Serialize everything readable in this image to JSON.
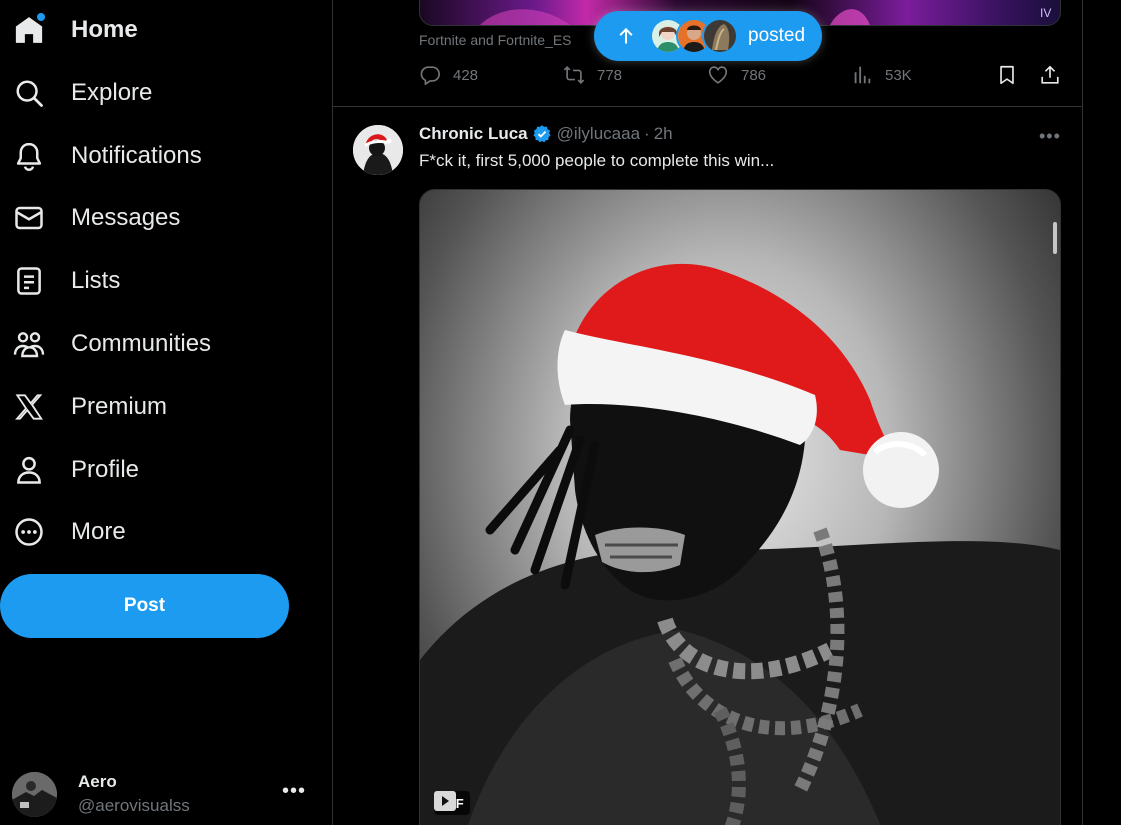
{
  "colors": {
    "accent": "#1d9bf0",
    "background": "#000000",
    "text": "#e7e9ea",
    "muted": "#71767b",
    "border": "#2f3336"
  },
  "sidebar": {
    "items": [
      {
        "label": "Home",
        "icon": "home-icon"
      },
      {
        "label": "Explore",
        "icon": "search-icon"
      },
      {
        "label": "Notifications",
        "icon": "bell-icon"
      },
      {
        "label": "Messages",
        "icon": "envelope-icon"
      },
      {
        "label": "Lists",
        "icon": "list-icon"
      },
      {
        "label": "Communities",
        "icon": "communities-icon"
      },
      {
        "label": "Premium",
        "icon": "x-logo-icon"
      },
      {
        "label": "Profile",
        "icon": "person-icon"
      },
      {
        "label": "More",
        "icon": "more-circle-icon"
      }
    ],
    "post_button": "Post",
    "account": {
      "name": "Aero",
      "handle": "@aerovisualss"
    }
  },
  "new_posts_pill": {
    "label": "posted"
  },
  "previous_tweet": {
    "source_label": "Fortnite and Fortnite_ES",
    "replies": "428",
    "reposts": "778",
    "likes": "786",
    "views": "53K"
  },
  "tweet": {
    "author": "Chronic Luca",
    "handle": "@ilylucaaa",
    "separator": "·",
    "time": "2h",
    "text": "F*ck it, first 5,000 people to complete this win...",
    "media_badge": "GIF"
  }
}
